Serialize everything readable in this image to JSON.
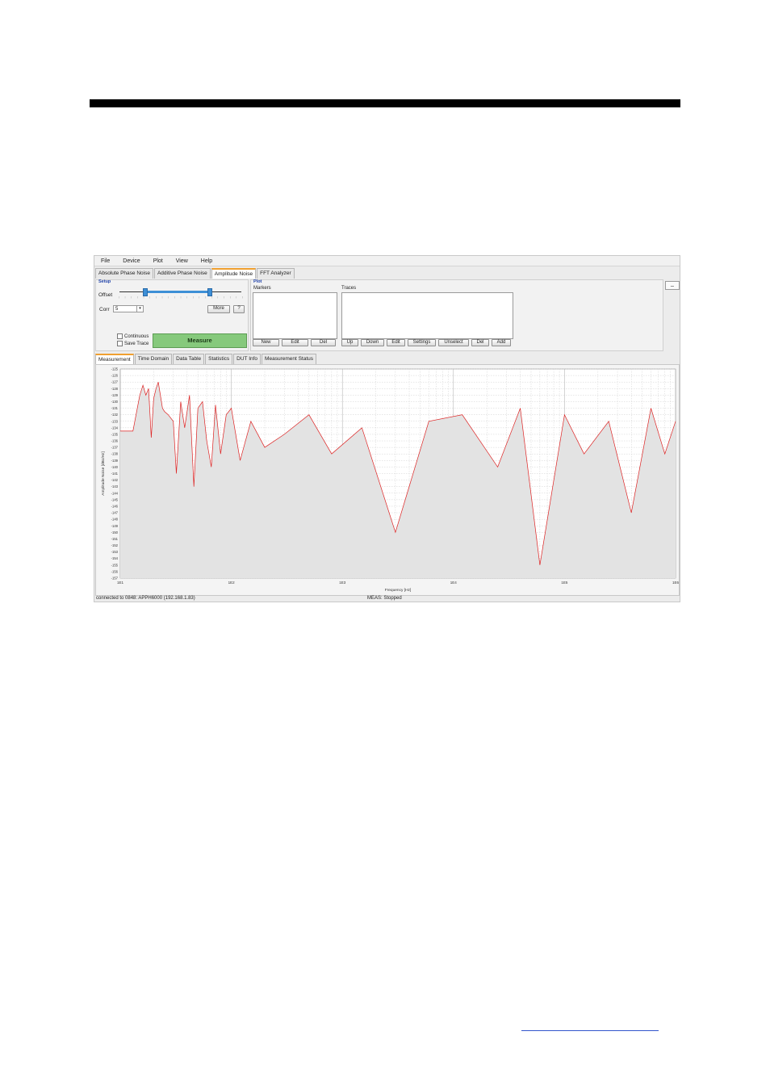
{
  "menu": [
    "File",
    "Device",
    "Plot",
    "View",
    "Help"
  ],
  "mode_tabs": [
    "Absolute Phase Noise",
    "Additive Phase Noise",
    "Amplitude Noise",
    "FFT Analyzer"
  ],
  "mode_tabs_active": 2,
  "setup": {
    "title": "Setup",
    "offset_label": "Offset",
    "corr_label": "Corr",
    "corr_value": "5",
    "more_label": "More",
    "help_label": "?",
    "continuous_label": "Continuous",
    "save_trace_label": "Save Trace",
    "measure_label": "Measure"
  },
  "plot_panel": {
    "title": "Plot",
    "markers_label": "Markers",
    "traces_label": "Traces",
    "marker_buttons": [
      "New",
      "Edit",
      "Del"
    ],
    "trace_buttons": [
      "Up",
      "Down",
      "Edit",
      "Settings",
      "Unselect",
      "Del",
      "Add"
    ],
    "collapse_label": "_"
  },
  "sub_tabs": [
    "Measurement",
    "Time Domain",
    "Data Table",
    "Statistics",
    "DUT Info",
    "Measurement Status"
  ],
  "sub_tabs_active": 0,
  "status": {
    "connection": "connected to 0848: APPH6000 (192.168.1.83)",
    "meas": "MEAS: Stopped"
  },
  "chart_data": {
    "type": "line",
    "xlabel": "Frequency [Hz]",
    "ylabel": "Amplitude Noise [dBc/Hz]",
    "x_scale": "log",
    "xlim": [
      10,
      1000000
    ],
    "ylim": [
      -157,
      -125
    ],
    "x_ticks": [
      "1E1",
      "1E2",
      "1E3",
      "1E4",
      "1E5",
      "1E6"
    ],
    "y_ticks": [
      "-125",
      "-126",
      "-127",
      "-128",
      "-129",
      "-130",
      "-131",
      "-132",
      "-133",
      "-134",
      "-135",
      "-136",
      "-137",
      "-138",
      "-139",
      "-140",
      "-141",
      "-142",
      "-143",
      "-144",
      "-145",
      "-146",
      "-147",
      "-148",
      "-149",
      "-150",
      "-151",
      "-152",
      "-153",
      "-154",
      "-155",
      "-156",
      "-157"
    ],
    "grid": true,
    "series": [
      {
        "color": "#dd2222",
        "x": [
          10,
          13,
          15,
          16,
          17,
          18,
          19,
          20,
          21,
          22,
          24,
          25,
          27,
          30,
          32,
          35,
          38,
          42,
          46,
          50,
          55,
          60,
          66,
          72,
          80,
          90,
          100,
          120,
          150,
          200,
          300,
          500,
          800,
          1500,
          3000,
          6000,
          12000,
          25000,
          40000,
          60000,
          100000,
          150000,
          250000,
          400000,
          600000,
          800000,
          1000000
        ],
        "values": [
          -134.5,
          -134.5,
          -129,
          -127.5,
          -129,
          -128,
          -135.5,
          -129.5,
          -128,
          -127,
          -131,
          -131.5,
          -132,
          -133,
          -141,
          -130,
          -134,
          -129,
          -143,
          -131,
          -130,
          -136,
          -140,
          -130.5,
          -138,
          -132,
          -131,
          -139,
          -133,
          -137,
          -135,
          -132,
          -138,
          -134,
          -150,
          -133,
          -132,
          -140,
          -131,
          -155,
          -132,
          -138,
          -133,
          -147,
          -131,
          -138,
          -133
        ]
      }
    ]
  }
}
